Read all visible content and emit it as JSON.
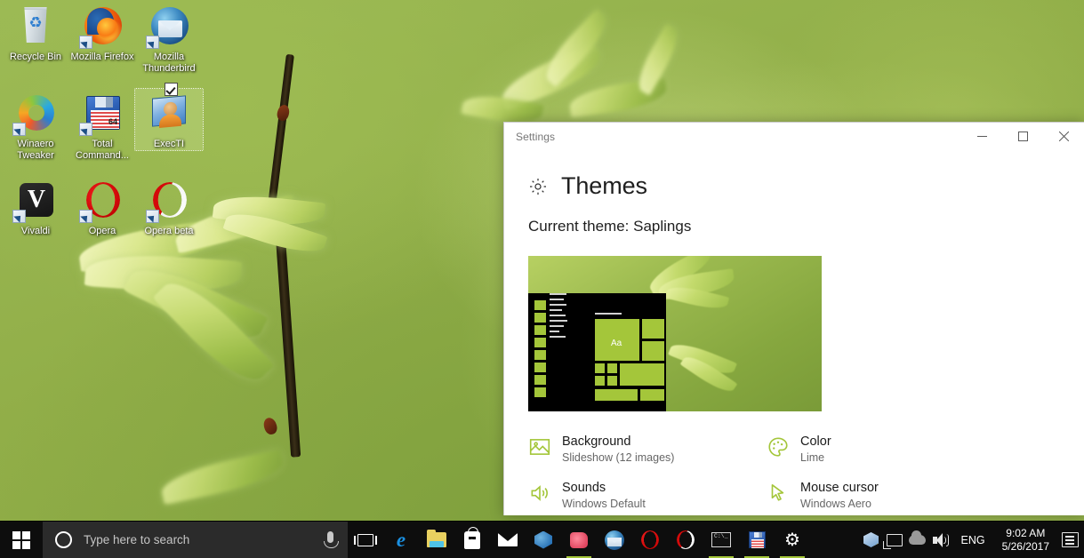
{
  "desktop": {
    "icons": [
      {
        "label": "Recycle Bin",
        "icon": "recycle-bin-icon",
        "shortcut": false,
        "selected": false
      },
      {
        "label": "Mozilla\nFirefox",
        "icon": "firefox-icon",
        "shortcut": true,
        "selected": false
      },
      {
        "label": "Mozilla\nThunderbird",
        "icon": "thunderbird-icon",
        "shortcut": true,
        "selected": false
      },
      {
        "label": "Winaero\nTweaker",
        "icon": "winaero-tweaker-icon",
        "shortcut": true,
        "selected": false
      },
      {
        "label": "Total\nCommand...",
        "icon": "total-commander-icon",
        "shortcut": true,
        "selected": false
      },
      {
        "label": "ExecTI",
        "icon": "execti-icon",
        "shortcut": false,
        "selected": true
      },
      {
        "label": "Vivaldi",
        "icon": "vivaldi-icon",
        "shortcut": true,
        "selected": false
      },
      {
        "label": "Opera",
        "icon": "opera-icon",
        "shortcut": true,
        "selected": false
      },
      {
        "label": "Opera beta",
        "icon": "opera-beta-icon",
        "shortcut": true,
        "selected": false
      }
    ],
    "wallpaper_description": "Green chestnut sapling leaves on dark branch"
  },
  "settings_window": {
    "title": "Settings",
    "controls": {
      "minimize": "─",
      "maximize": "☐",
      "close": "✕"
    },
    "page": {
      "icon": "gear-icon",
      "title": "Themes",
      "current_theme_label": "Current theme: Saplings",
      "preview": {
        "tile_text": "Aa",
        "tile_color": "#a4c63a",
        "start_menu_background": "#000000"
      },
      "options": [
        {
          "icon": "picture-icon",
          "title": "Background",
          "value": "Slideshow (12 images)"
        },
        {
          "icon": "palette-icon",
          "title": "Color",
          "value": "Lime"
        },
        {
          "icon": "speaker-icon",
          "title": "Sounds",
          "value": "Windows Default"
        },
        {
          "icon": "mouse-cursor-icon",
          "title": "Mouse cursor",
          "value": "Windows Aero"
        }
      ]
    }
  },
  "taskbar": {
    "start_button": "start-button",
    "search": {
      "placeholder": "Type here to search",
      "cortana_icon": "cortana-circle-icon",
      "mic_icon": "microphone-icon"
    },
    "apps": [
      {
        "name": "task-view",
        "icon": "task-view-icon",
        "active": false
      },
      {
        "name": "microsoft-edge",
        "icon": "edge-icon",
        "active": false
      },
      {
        "name": "file-explorer",
        "icon": "file-explorer-icon",
        "active": false
      },
      {
        "name": "microsoft-store",
        "icon": "store-icon",
        "active": false
      },
      {
        "name": "mail",
        "icon": "mail-icon",
        "active": false
      },
      {
        "name": "gimp",
        "icon": "gimp-icon",
        "active": false
      },
      {
        "name": "paint",
        "icon": "paint-icon",
        "active": true
      },
      {
        "name": "thunderbird",
        "icon": "thunderbird-icon",
        "active": false
      },
      {
        "name": "opera",
        "icon": "opera-icon",
        "active": false
      },
      {
        "name": "opera-beta",
        "icon": "opera-beta-icon",
        "active": false
      },
      {
        "name": "command-prompt",
        "icon": "command-prompt-icon",
        "active": true
      },
      {
        "name": "total-commander",
        "icon": "total-commander-icon",
        "active": true
      },
      {
        "name": "settings",
        "icon": "gear-icon",
        "active": true
      }
    ],
    "tray": [
      {
        "name": "package-tray",
        "icon": "package-icon"
      },
      {
        "name": "network-tray",
        "icon": "network-icon"
      },
      {
        "name": "onedrive-tray",
        "icon": "cloud-icon"
      },
      {
        "name": "volume-tray",
        "icon": "speaker-icon"
      }
    ],
    "language": "ENG",
    "clock": {
      "time": "9:02 AM",
      "date": "5/26/2017"
    },
    "notifications_icon": "action-center-icon"
  },
  "colors": {
    "accent_lime": "#a4c63a",
    "taskbar_bg": "#0d0d0d",
    "search_bg": "#2b2b2b",
    "window_bg": "#ffffff",
    "wallpaper_green": "#93b04a"
  }
}
